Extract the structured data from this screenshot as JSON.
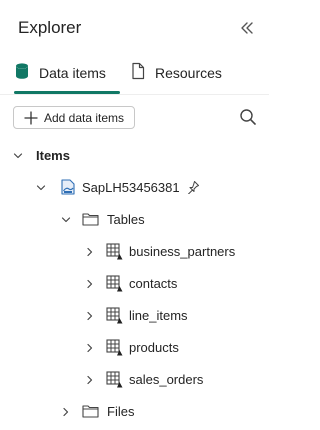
{
  "panel": {
    "title": "Explorer"
  },
  "tabs": [
    {
      "label": "Data items",
      "selected": true
    },
    {
      "label": "Resources",
      "selected": false
    }
  ],
  "toolbar": {
    "add_label": "Add data items"
  },
  "tree": {
    "section_label": "Items",
    "lakehouse": {
      "name": "SapLH53456381"
    },
    "tables_folder": "Tables",
    "tables": [
      "business_partners",
      "contacts",
      "line_items",
      "products",
      "sales_orders"
    ],
    "files_folder": "Files"
  },
  "colors": {
    "accent": "#117865",
    "text": "#242424",
    "icon": "#444444"
  }
}
